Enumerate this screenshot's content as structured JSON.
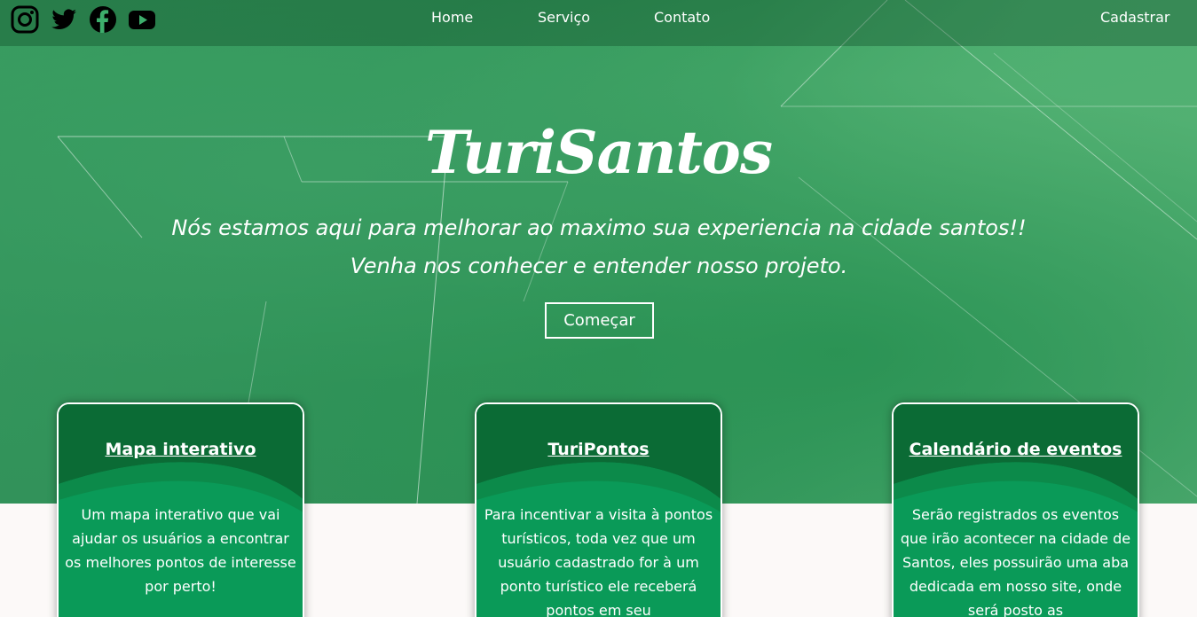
{
  "header": {
    "socials": [
      {
        "icon": "instagram-icon"
      },
      {
        "icon": "twitter-icon"
      },
      {
        "icon": "facebook-icon"
      },
      {
        "icon": "youtube-icon"
      }
    ],
    "nav": {
      "home": "Home",
      "service": "Serviço",
      "contact": "Contato",
      "signup": "Cadastrar"
    }
  },
  "hero": {
    "title": "TuriSantos",
    "subtitle": "Nós estamos aqui para melhorar ao maximo sua experiencia na cidade santos!! Venha nos conhecer e entender nosso projeto.",
    "start_label": "Começar"
  },
  "cards": [
    {
      "title": "Mapa interativo",
      "text": "Um mapa interativo que vai ajudar os usuários a encontrar os melhores pontos de interesse por perto!"
    },
    {
      "title": "TuriPontos",
      "text": "Para incentivar a visita à pontos turísticos, toda vez que um usuário cadastrado for à um ponto turístico ele receberá pontos em seu"
    },
    {
      "title": "Calendário de eventos",
      "text": "Serão registrados os eventos que irão acontecer na cidade de Santos, eles possuirão uma aba dedicada em nosso site, onde será posto as"
    }
  ],
  "colors": {
    "hero_overlay": "#2eaa60",
    "card_dark": "#0b6b35",
    "card_light": "#0a9a58",
    "text": "#ffffff"
  }
}
